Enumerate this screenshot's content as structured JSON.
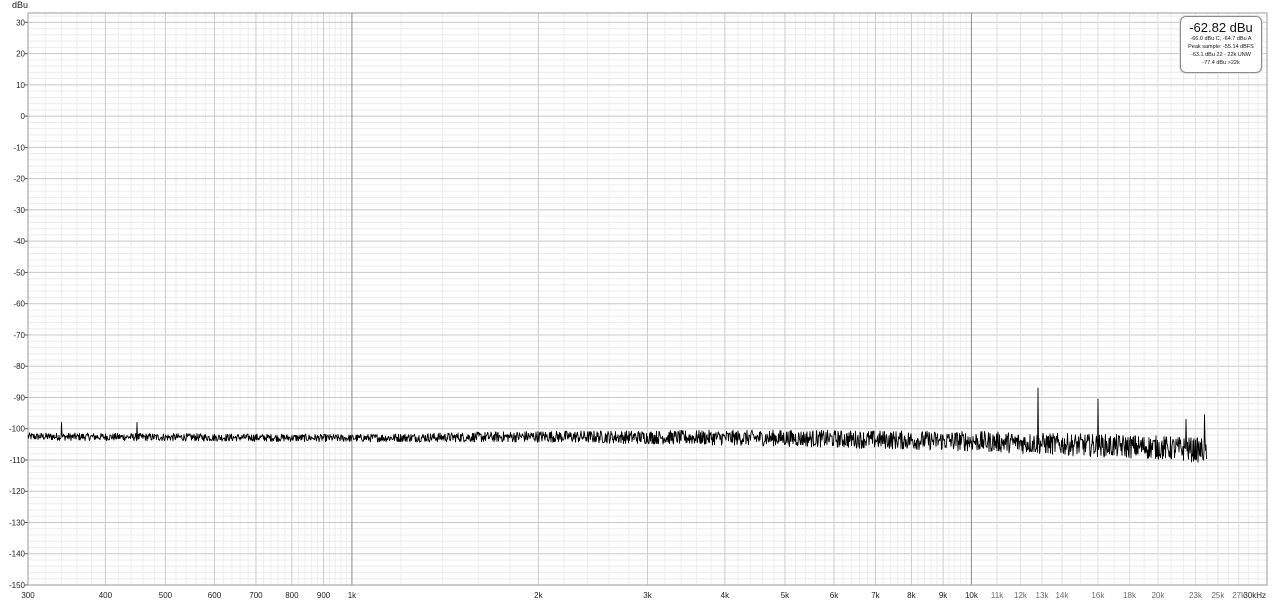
{
  "chart_data": {
    "type": "line",
    "ylabel": "dBu",
    "xlabel": "",
    "x_unit": "kHz",
    "x_scale": "log",
    "xlim": [
      300,
      30000
    ],
    "ylim": [
      -150,
      33
    ],
    "grid": true,
    "x_major_ticks": [
      {
        "value": 300,
        "label": "300"
      },
      {
        "value": 400,
        "label": "400"
      },
      {
        "value": 500,
        "label": "500"
      },
      {
        "value": 600,
        "label": "600"
      },
      {
        "value": 700,
        "label": "700"
      },
      {
        "value": 800,
        "label": "800"
      },
      {
        "value": 900,
        "label": "900"
      },
      {
        "value": 1000,
        "label": "1k"
      },
      {
        "value": 2000,
        "label": "2k"
      },
      {
        "value": 3000,
        "label": "3k"
      },
      {
        "value": 4000,
        "label": "4k"
      },
      {
        "value": 5000,
        "label": "5k"
      },
      {
        "value": 6000,
        "label": "6k"
      },
      {
        "value": 7000,
        "label": "7k"
      },
      {
        "value": 8000,
        "label": "8k"
      },
      {
        "value": 9000,
        "label": "9k"
      },
      {
        "value": 10000,
        "label": "10k"
      }
    ],
    "x_minor_ticks": [
      {
        "value": 11000,
        "label": "11k"
      },
      {
        "value": 12000,
        "label": "12k"
      },
      {
        "value": 13000,
        "label": "13k"
      },
      {
        "value": 14000,
        "label": "14k"
      },
      {
        "value": 16000,
        "label": "16k"
      },
      {
        "value": 18000,
        "label": "18k"
      },
      {
        "value": 20000,
        "label": "20k"
      },
      {
        "value": 23000,
        "label": "23k"
      },
      {
        "value": 25000,
        "label": "25k"
      },
      {
        "value": 27000,
        "label": "27k"
      },
      {
        "value": 30000,
        "label": "30kHz"
      }
    ],
    "y_ticks": [
      30,
      20,
      10,
      0,
      -10,
      -20,
      -30,
      -40,
      -50,
      -60,
      -70,
      -80,
      -90,
      -100,
      -110,
      -120,
      -130,
      -140,
      -150
    ],
    "series": [
      {
        "color": "#000000",
        "noise_floor": {
          "x": [
            300,
            1000,
            2000,
            5000,
            10000,
            20000,
            24000
          ],
          "y": [
            -102.5,
            -103,
            -102.5,
            -103,
            -104,
            -106,
            -107
          ]
        },
        "spikes": [
          {
            "x": 340,
            "y": -98
          },
          {
            "x": 450,
            "y": -98
          },
          {
            "x": 12800,
            "y": -87
          },
          {
            "x": 16000,
            "y": -90.5
          },
          {
            "x": 22200,
            "y": -97
          },
          {
            "x": 23800,
            "y": -95.5
          }
        ],
        "x_end": 24000
      }
    ]
  },
  "readout": {
    "main": "-62.82 dBu",
    "line1": "-66.0 dBu C, -64.7 dBu A",
    "line2": "Peak sample: -55.14 dBFS",
    "line3": "-63.1 dBu 22 - 22k UNW",
    "line4": "-77.4 dBu >22k"
  }
}
